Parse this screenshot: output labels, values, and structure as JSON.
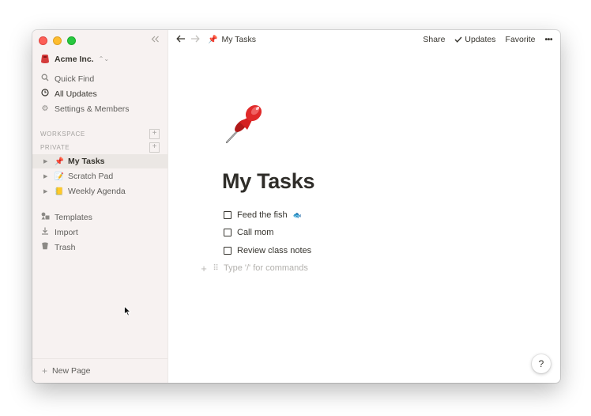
{
  "sidebar": {
    "workspace_name": "Acme Inc.",
    "top_items": [
      {
        "label": "Quick Find",
        "icon": "search-icon"
      },
      {
        "label": "All Updates",
        "icon": "clock-icon"
      },
      {
        "label": "Settings & Members",
        "icon": "gear-icon"
      }
    ],
    "section_workspace": "WORKSPACE",
    "section_private": "PRIVATE",
    "pages": [
      {
        "label": "My Tasks",
        "emoji": "📌"
      },
      {
        "label": "Scratch Pad",
        "emoji": "📝"
      },
      {
        "label": "Weekly Agenda",
        "emoji": "📒"
      }
    ],
    "bottom_items": [
      {
        "label": "Templates",
        "icon": "templates-icon"
      },
      {
        "label": "Import",
        "icon": "download-icon"
      },
      {
        "label": "Trash",
        "icon": "trash-icon"
      }
    ],
    "new_page_label": "New Page"
  },
  "topbar": {
    "breadcrumb_emoji": "📌",
    "breadcrumb_label": "My Tasks",
    "share_label": "Share",
    "updates_label": "Updates",
    "favorite_label": "Favorite",
    "more_label": "•••"
  },
  "page": {
    "icon": "pushpin-icon",
    "title": "My Tasks",
    "todos": [
      {
        "label": "Feed the fish",
        "checked": false,
        "emoji": "🐟"
      },
      {
        "label": "Call mom",
        "checked": false,
        "emoji": ""
      },
      {
        "label": "Review class notes",
        "checked": false,
        "emoji": ""
      }
    ],
    "placeholder": "Type '/' for commands"
  },
  "help_label": "?",
  "colors": {
    "sidebar_bg": "#f7f2f1",
    "selected_bg": "#ebe7e4",
    "text": "#37352f",
    "pin_red": "#d42020"
  }
}
